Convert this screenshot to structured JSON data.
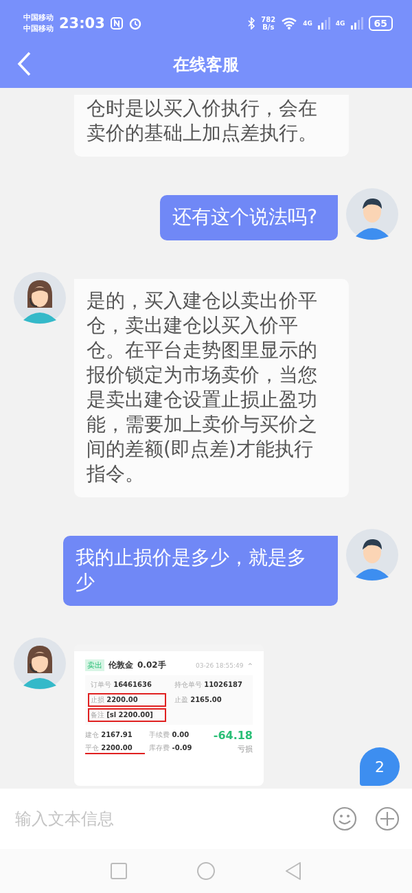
{
  "status_bar": {
    "carriers": [
      "中国移动",
      "中国移动"
    ],
    "time": "23:03",
    "net_speed": [
      "782",
      "B/s"
    ],
    "signals": [
      "4G",
      "4G"
    ],
    "battery": "65"
  },
  "header": {
    "title": "在线客服"
  },
  "messages": [
    {
      "kind": "continued",
      "text": "仓时是以买入价执行，会在卖价的基础上加点差执行。"
    },
    {
      "kind": "outgoing",
      "text": "还有这个说法吗?"
    },
    {
      "kind": "incoming",
      "text": "是的，买入建仓以卖出价平仓，卖出建仓以买入价平仓。在平台走势图里显示的报价锁定为市场卖价，当您是卖出建仓设置止损止盈功能，需要加上卖价与买价之间的差额(即点差)才能执行指令。"
    },
    {
      "kind": "outgoing",
      "text": "我的止损价是多少，就是多少"
    },
    {
      "kind": "image",
      "screenshot": {
        "tag": "卖出",
        "symbol": "伦敦金",
        "lots": "0.02手",
        "time": "03-26 18:55:49",
        "caret": "^",
        "details": [
          {
            "label": "订单号",
            "value": "16461636",
            "highlighted": false
          },
          {
            "label": "持仓单号",
            "value": "11026187",
            "highlighted": false
          },
          {
            "label": "止损",
            "value": "2200.00",
            "highlighted": true
          },
          {
            "label": "止盈",
            "value": "2165.00",
            "highlighted": false
          },
          {
            "label": "备注",
            "value": "[sl 2200.00]",
            "highlighted": true
          }
        ],
        "prices": [
          {
            "label": "建仓",
            "value": "2167.91",
            "underlined": false
          },
          {
            "label": "手续费",
            "value": "0.00",
            "underlined": false
          },
          {
            "label": "平仓",
            "value": "2200.00",
            "underlined": true
          },
          {
            "label": "库存费",
            "value": "-0.09",
            "underlined": false
          }
        ],
        "profit": "-64.18",
        "profit_label": "亏损"
      }
    }
  ],
  "unread_badge": "2",
  "input": {
    "placeholder": "输入文本信息"
  }
}
